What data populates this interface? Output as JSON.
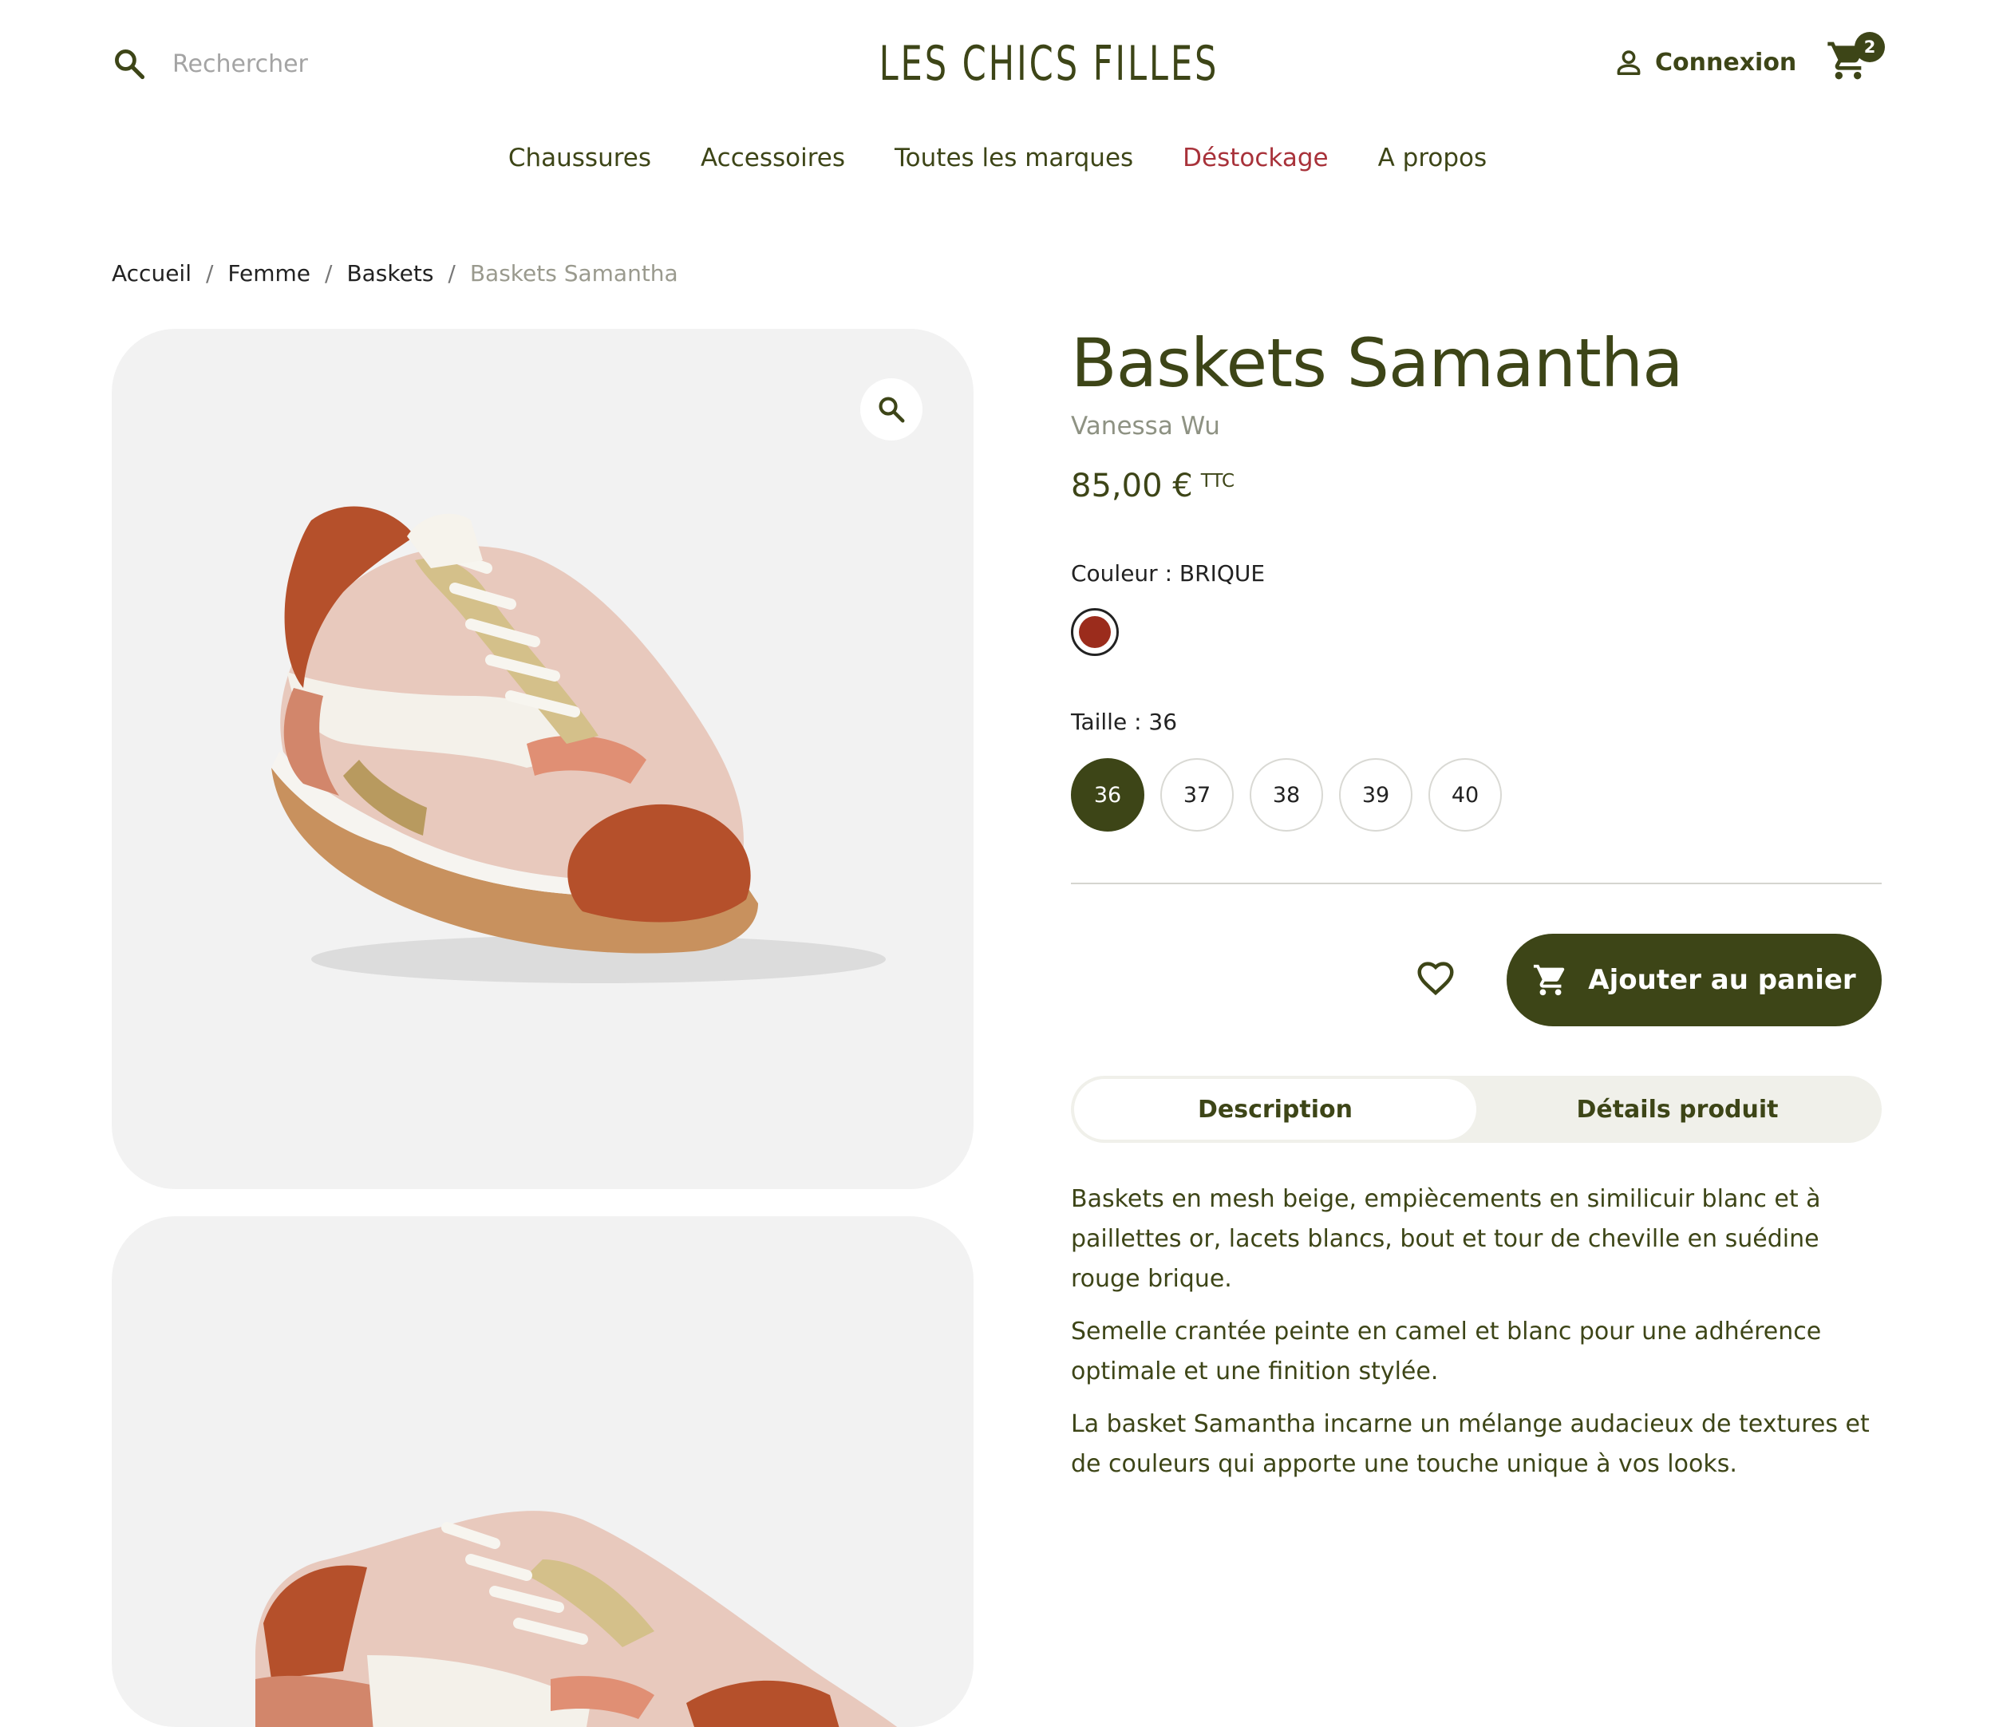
{
  "header": {
    "search_placeholder": "Rechercher",
    "logo": "LES CHICS FILLES",
    "login_label": "Connexion",
    "cart_count": "2"
  },
  "nav": {
    "items": [
      "Chaussures",
      "Accessoires",
      "Toutes les marques",
      "Déstockage",
      "A propos"
    ]
  },
  "breadcrumb": {
    "items": [
      "Accueil",
      "Femme",
      "Baskets"
    ],
    "separator": "/",
    "current": "Baskets Samantha"
  },
  "product": {
    "title": "Baskets Samantha",
    "brand": "Vanessa Wu",
    "price": "85,00 €",
    "price_tax": "TTC",
    "color_label": "Couleur : BRIQUE",
    "color_swatch": "#9b2c1c",
    "size_label": "Taille : 36",
    "sizes": [
      "36",
      "37",
      "38",
      "39",
      "40"
    ],
    "selected_size": "36",
    "add_to_cart_label": "Ajouter au panier",
    "tabs": [
      "Description",
      "Détails produit"
    ],
    "active_tab": "Description",
    "description": [
      "Baskets en mesh beige, empiècements en similicuir blanc et à paillettes or, lacets blancs, bout et tour de cheville en suédine rouge brique.",
      "Semelle crantée peinte en camel et blanc pour une adhérence optimale et une finition stylée.",
      "La basket Samantha incarne un mélange audacieux de textures et de couleurs qui apporte une touche unique à vos looks."
    ]
  },
  "icons": {
    "search": "search-icon",
    "account": "account-icon",
    "cart": "cart-icon",
    "zoom": "zoom-icon",
    "wishlist": "heart-icon"
  },
  "colors": {
    "primary": "#3d4517",
    "sale": "#a8323a",
    "muted": "#8e9283",
    "surface": "#f2f2f2"
  }
}
